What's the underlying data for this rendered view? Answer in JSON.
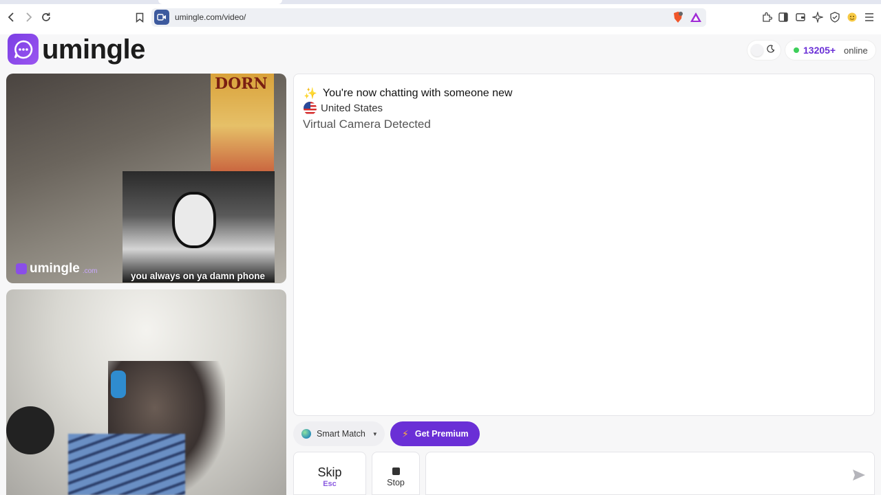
{
  "browser": {
    "url": "umingle.com/video/"
  },
  "header": {
    "logo_text": "umingle",
    "online_count": "13205+",
    "online_label": "online"
  },
  "remote_video": {
    "watermark_text": "umingle",
    "watermark_suffix": ".com",
    "poster_title": "DORN",
    "meme_caption": "you always on ya damn phone"
  },
  "chat": {
    "sparkle_icon": "sparkles-icon",
    "status_message": "You're now chatting with someone new",
    "flag_icon": "us-flag-icon",
    "country": "United States",
    "notice": "Virtual Camera Detected"
  },
  "controls": {
    "match_mode_label": "Smart Match",
    "premium_label": "Get Premium",
    "skip_label": "Skip",
    "skip_key": "Esc",
    "stop_label": "Stop",
    "message_placeholder": ""
  },
  "colors": {
    "brand_purple": "#6a2fd6",
    "online_green": "#3ecf5a"
  }
}
